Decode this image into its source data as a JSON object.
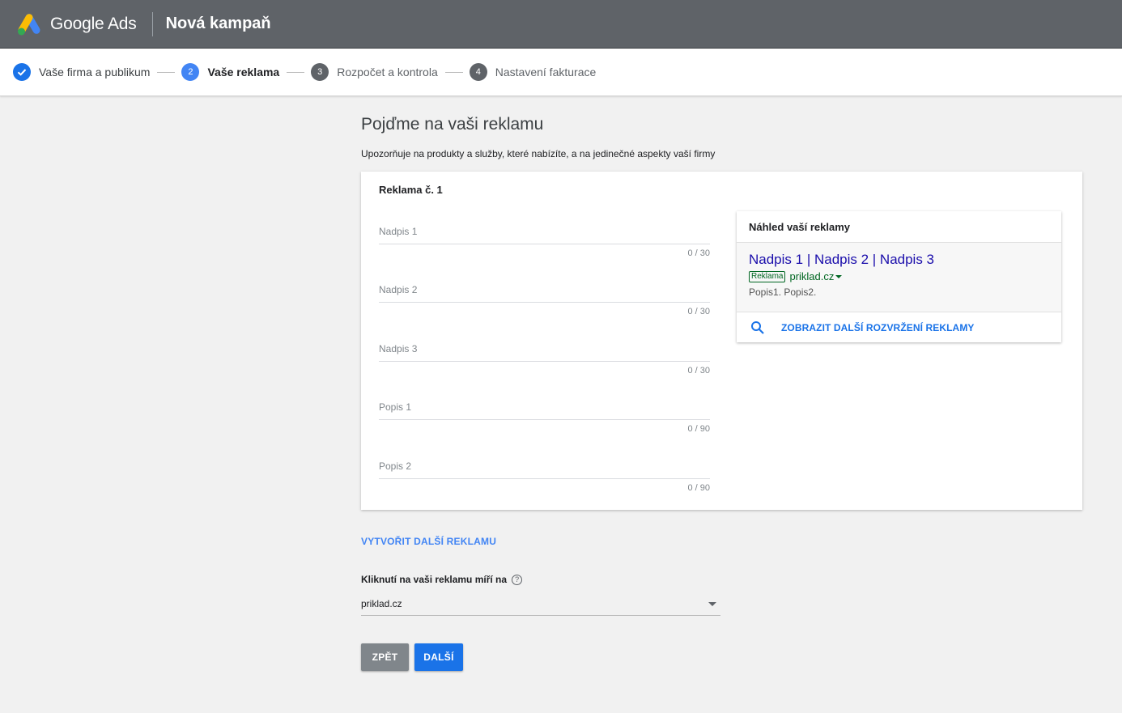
{
  "header": {
    "brand": "Google Ads",
    "campaign_title": "Nová kampaň"
  },
  "steps": [
    {
      "number": "",
      "label": "Vaše firma a publikum",
      "state": "done"
    },
    {
      "number": "2",
      "label": "Vaše reklama",
      "state": "active"
    },
    {
      "number": "3",
      "label": "Rozpočet a kontrola",
      "state": "idle"
    },
    {
      "number": "4",
      "label": "Nastavení fakturace",
      "state": "idle"
    }
  ],
  "page": {
    "title": "Pojďme na vaši reklamu",
    "subtitle": "Upozorňuje na produkty a služby, které nabízíte, a na jedinečné aspekty vaší firmy"
  },
  "ad_card": {
    "title": "Reklama č. 1",
    "fields": [
      {
        "label": "Nadpis 1",
        "value": "",
        "counter": "0 / 30"
      },
      {
        "label": "Nadpis 2",
        "value": "",
        "counter": "0 / 30"
      },
      {
        "label": "Nadpis 3",
        "value": "",
        "counter": "0 / 30"
      },
      {
        "label": "Popis 1",
        "value": "",
        "counter": "0 / 90"
      },
      {
        "label": "Popis 2",
        "value": "",
        "counter": "0 / 90"
      }
    ]
  },
  "preview": {
    "heading": "Náhled vaší reklamy",
    "headline": "Nadpis 1 | Nadpis 2 | Nadpis 3",
    "badge": "Reklama",
    "url": "priklad.cz",
    "description": "Popis1. Popis2.",
    "more_layouts": "ZOBRAZIT DALŠÍ ROZVRŽENÍ REKLAMY"
  },
  "create_more_link": "VYTVOŘIT DALŠÍ REKLAMU",
  "click_target": {
    "label": "Kliknutí na vaši reklamu míří na",
    "value": "priklad.cz"
  },
  "buttons": {
    "back": "ZPĚT",
    "next": "DALŠÍ"
  },
  "colors": {
    "topbar": "#5f6368",
    "accent": "#1a73e8",
    "ad_headline": "#1a0dab",
    "ad_url": "#006621"
  },
  "icons": {
    "logo": "google-ads-logo",
    "done": "check-icon",
    "preview": "search-icon",
    "help": "help-icon",
    "select": "chevron-down-icon"
  }
}
